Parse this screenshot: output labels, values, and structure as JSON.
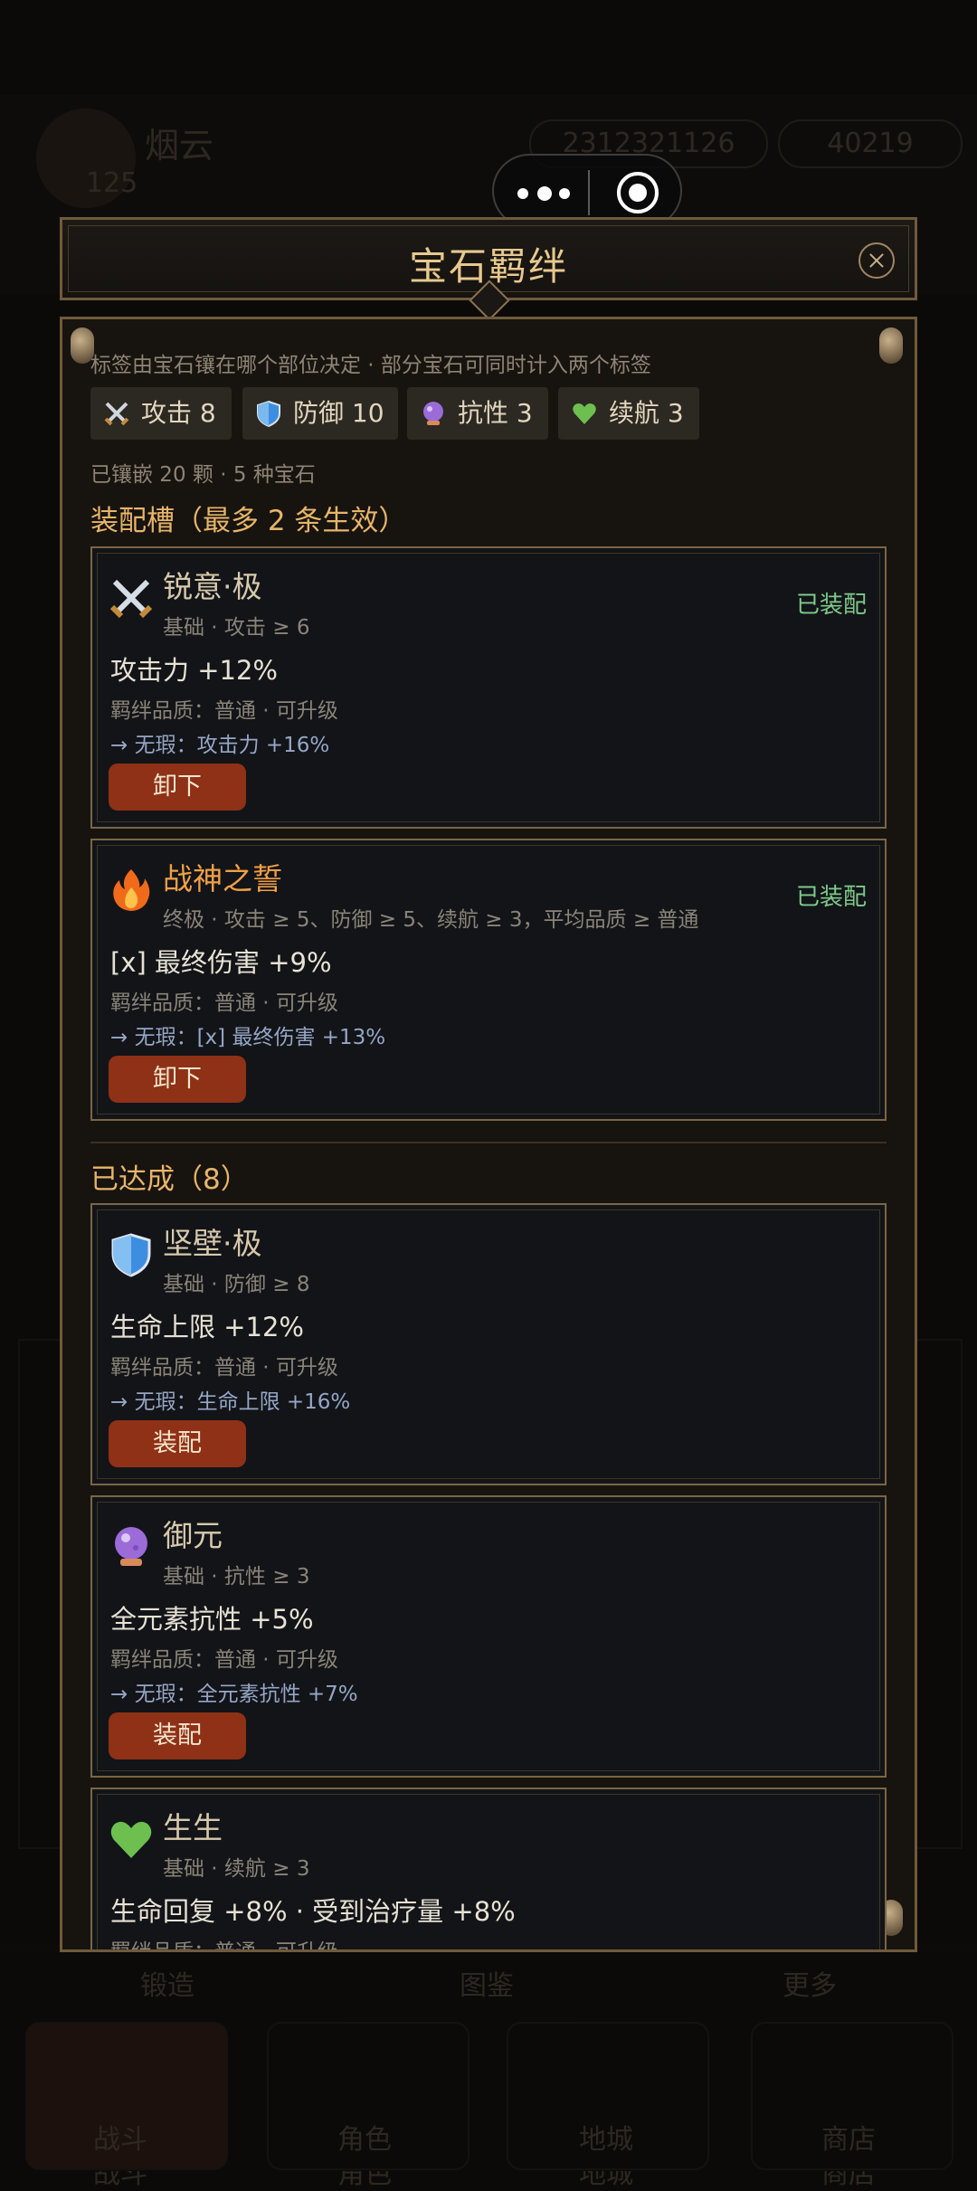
{
  "background": {
    "player_name": "烟云",
    "level": "125",
    "gold": "2312321126",
    "gems": "40219",
    "subtabs": [
      "锻造",
      "图鉴",
      "更多"
    ],
    "nav": [
      "战斗",
      "角色",
      "地城",
      "商店"
    ]
  },
  "modal": {
    "title": "宝石羁绊",
    "note": "标签由宝石镶在哪个部位决定 · 部分宝石可同时计入两个标签",
    "tags": [
      {
        "label": "攻击 8",
        "icon": "sword-icon"
      },
      {
        "label": "防御 10",
        "icon": "shield-icon"
      },
      {
        "label": "抗性 3",
        "icon": "crystal-ball-icon"
      },
      {
        "label": "续航 3",
        "icon": "heart-icon"
      }
    ],
    "summary": "已镶嵌 20 颗 · 5 种宝石",
    "equipped_title": "装配槽（最多 2 条生效）",
    "achieved_title": "已达成（8）"
  },
  "equipped": [
    {
      "icon": "sword-icon",
      "name": "锐意·极",
      "req": "基础 · 攻击 ≥ 6",
      "status": "已装配",
      "effect": "攻击力 +12%",
      "quality": "羁绊品质：普通 · 可升级",
      "upgrade": "→ 无瑕：攻击力 +16%",
      "button": "卸下"
    },
    {
      "icon": "fire-icon",
      "name": "战神之誓",
      "req": "终极 · 攻击 ≥ 5、防御 ≥ 5、续航 ≥ 3，平均品质 ≥ 普通",
      "status": "已装配",
      "effect": "[x] 最终伤害 +9%",
      "quality": "羁绊品质：普通 · 可升级",
      "upgrade": "→ 无瑕：[x] 最终伤害 +13%",
      "button": "卸下"
    }
  ],
  "achieved": [
    {
      "icon": "shield-icon",
      "name": "坚壁·极",
      "req": "基础 · 防御 ≥ 8",
      "effect": "生命上限 +12%",
      "quality": "羁绊品质：普通 · 可升级",
      "upgrade": "→ 无瑕：生命上限 +16%",
      "button": "装配"
    },
    {
      "icon": "crystal-ball-icon",
      "name": "御元",
      "req": "基础 · 抗性 ≥ 3",
      "effect": "全元素抗性 +5%",
      "quality": "羁绊品质：普通 · 可升级",
      "upgrade": "→ 无瑕：全元素抗性 +7%",
      "button": "装配"
    },
    {
      "icon": "heart-icon",
      "name": "生生",
      "req": "基础 · 续航 ≥ 3",
      "effect": "生命回复 +8% · 受到治疗量 +8%",
      "quality": "羁绊品质：普通 · 可升级"
    }
  ],
  "colors": {
    "accent_gold": "#e7c98e",
    "button_red": "#8e3116",
    "equipped_green": "#7fc98a",
    "legend_orange": "#f0a046"
  }
}
